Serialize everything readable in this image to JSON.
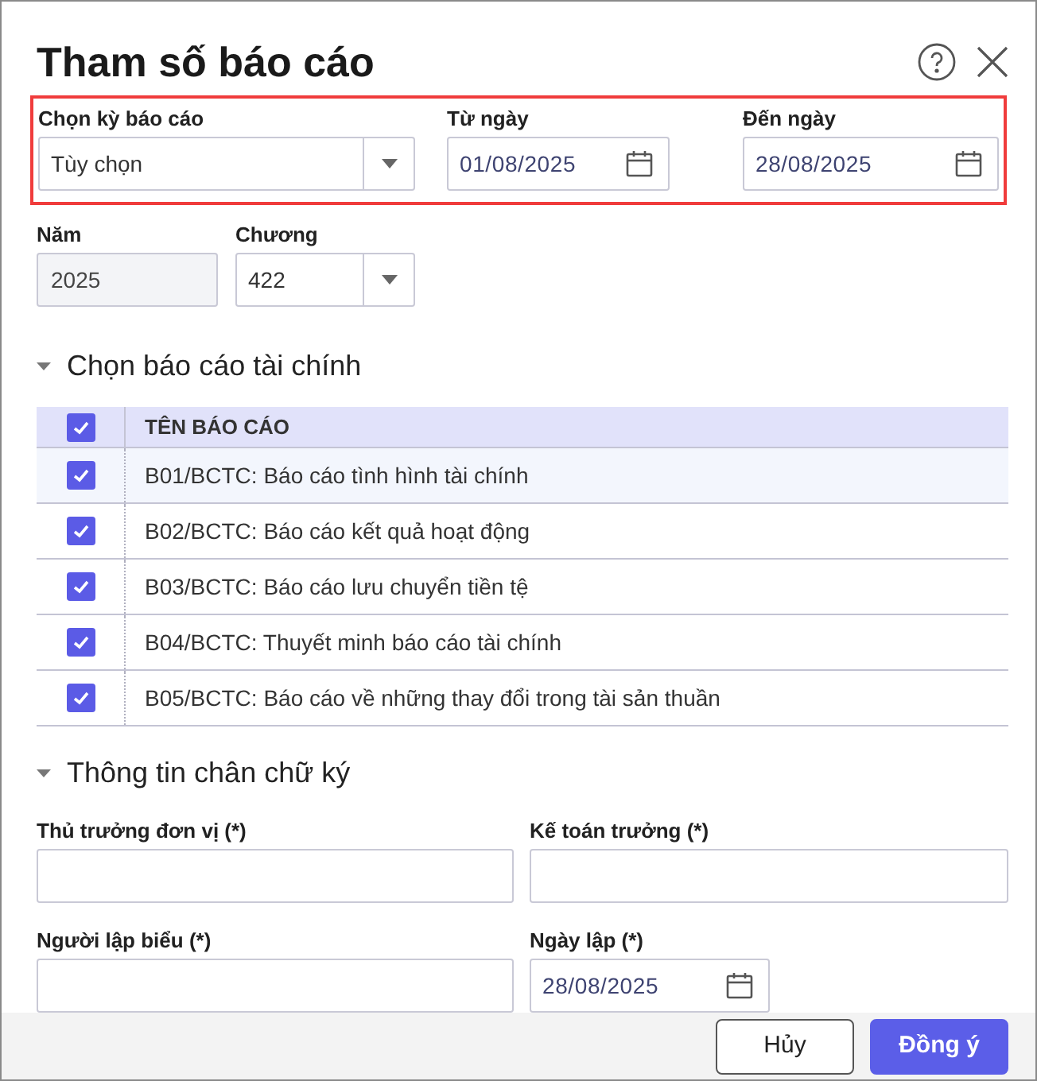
{
  "dialog": {
    "title": "Tham số báo cáo"
  },
  "period": {
    "period_type": {
      "label": "Chọn kỳ báo cáo",
      "value": "Tùy chọn"
    },
    "from_date": {
      "label": "Từ ngày",
      "value": "01/08/2025"
    },
    "to_date": {
      "label": "Đến ngày",
      "value": "28/08/2025"
    }
  },
  "year": {
    "label": "Năm",
    "value": "2025",
    "disabled": true
  },
  "chapter": {
    "label": "Chương",
    "value": "422"
  },
  "report_section": {
    "title": "Chọn báo cáo tài chính",
    "expanded": true
  },
  "report_table": {
    "header_checked": true,
    "column": "TÊN BÁO CÁO",
    "rows": [
      {
        "name": "B01/BCTC: Báo cáo tình hình tài chính",
        "checked": true,
        "selected": true
      },
      {
        "name": "B02/BCTC: Báo cáo kết quả hoạt động",
        "checked": true,
        "selected": false
      },
      {
        "name": "B03/BCTC: Báo cáo lưu chuyển tiền tệ",
        "checked": true,
        "selected": false
      },
      {
        "name": "B04/BCTC: Thuyết minh báo cáo tài chính",
        "checked": true,
        "selected": false
      },
      {
        "name": "B05/BCTC: Báo cáo về những thay đổi trong tài sản thuần",
        "checked": true,
        "selected": false
      }
    ]
  },
  "signature_section": {
    "title": "Thông tin chân chữ ký",
    "expanded": true
  },
  "signature_fields": [
    {
      "kind": "text",
      "label": "Thủ trưởng đơn vị (*)"
    },
    {
      "kind": "text",
      "label": "Kế toán trưởng (*)"
    },
    {
      "kind": "text",
      "label": "Người lập biểu (*)"
    },
    {
      "kind": "date",
      "label": "Ngày lập (*)",
      "value": "28/08/2025"
    }
  ],
  "buttons": [
    {
      "kind": "secondary",
      "label": "Hủy"
    },
    {
      "kind": "primary",
      "label": "Đồng ý"
    }
  ]
}
